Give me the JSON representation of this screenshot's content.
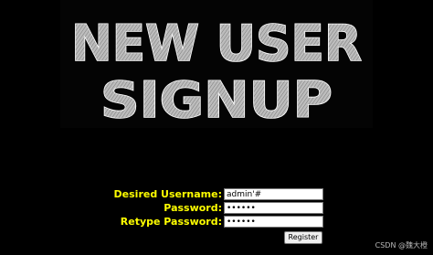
{
  "banner": {
    "line1": "NEW USER",
    "line2": "SIGNUP"
  },
  "form": {
    "username_label": "Desired Username:",
    "username_value": "admin'#",
    "password_label": "Password:",
    "password_value": "••••••",
    "retype_label": "Retype Password:",
    "retype_value": "••••••",
    "register_label": "Register"
  },
  "watermark": "CSDN @魏大橙",
  "colors": {
    "background": "#000000",
    "label": "#ffff00",
    "banner_fill": "#b8b8b8",
    "banner_outline": "#1a1a1a"
  }
}
